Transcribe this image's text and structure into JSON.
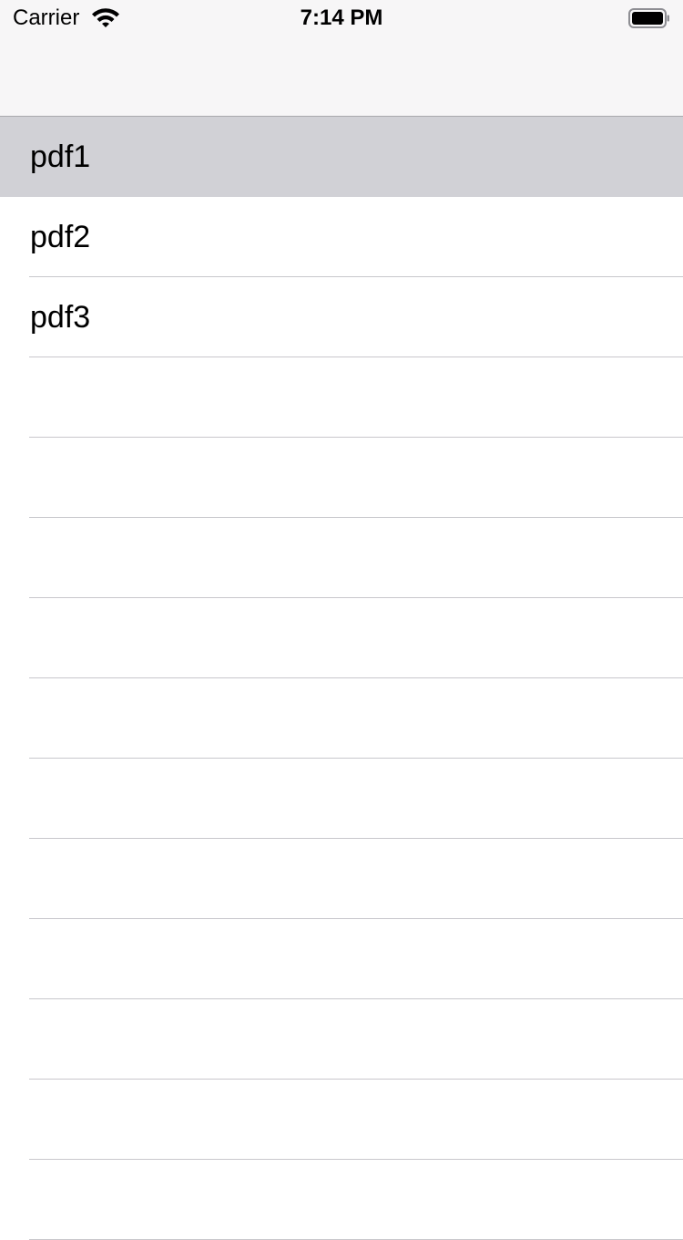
{
  "status_bar": {
    "carrier": "Carrier",
    "time": "7:14 PM",
    "wifi_icon": "wifi-icon",
    "battery_icon": "battery-icon"
  },
  "list": {
    "items": [
      {
        "label": "pdf1",
        "selected": true
      },
      {
        "label": "pdf2",
        "selected": false
      },
      {
        "label": "pdf3",
        "selected": false
      }
    ],
    "empty_rows": 11
  },
  "colors": {
    "nav_background": "#f7f6f7",
    "selected_row": "#d1d1d6",
    "separator": "#c8c7cc"
  }
}
